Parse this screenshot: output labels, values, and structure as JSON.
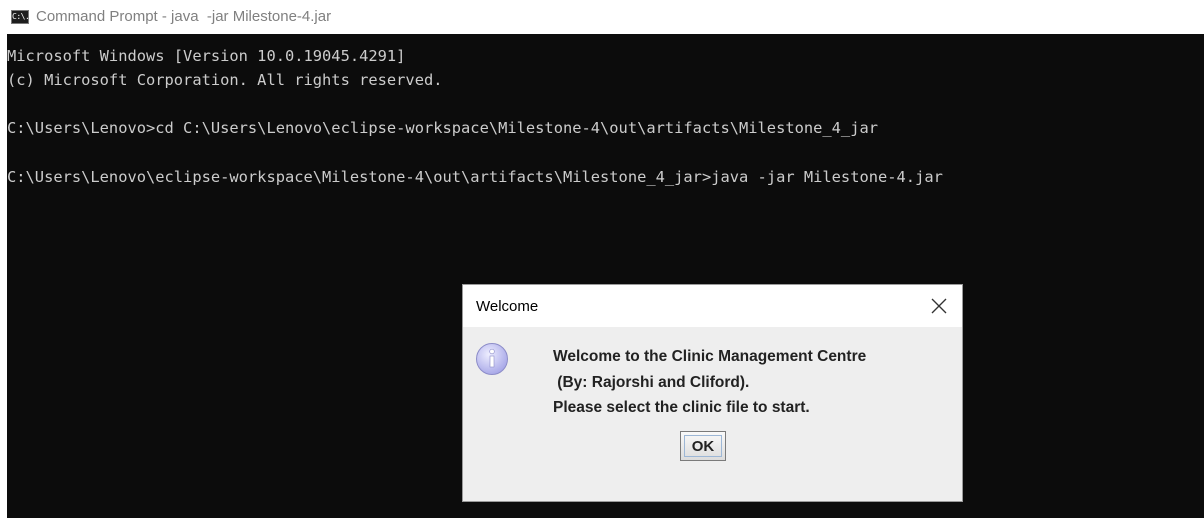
{
  "window": {
    "title": "Command Prompt - java  -jar Milestone-4.jar",
    "icon": "cmd-icon",
    "icon_text": "C:\\."
  },
  "console": {
    "lines": [
      "Microsoft Windows [Version 10.0.19045.4291]",
      "(c) Microsoft Corporation. All rights reserved.",
      "C:\\Users\\Lenovo>cd C:\\Users\\Lenovo\\eclipse-workspace\\Milestone-4\\out\\artifacts\\Milestone_4_jar",
      "C:\\Users\\Lenovo\\eclipse-workspace\\Milestone-4\\out\\artifacts\\Milestone_4_jar>java -jar Milestone-4.jar"
    ]
  },
  "dialog": {
    "title": "Welcome",
    "icon": "info-icon",
    "close_icon": "close-icon",
    "message_lines": [
      "Welcome to the Clinic Management Centre",
      " (By: Rajorshi and Cliford).",
      "Please select the clinic file to start."
    ],
    "ok_label": "OK"
  },
  "colors": {
    "console_bg": "#0c0c0c",
    "console_text": "#cccccc",
    "dialog_body": "#eeeeee",
    "info_icon": "#b8b8f0"
  }
}
